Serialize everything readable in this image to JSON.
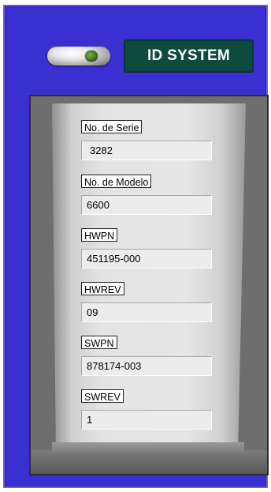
{
  "header": {
    "title": "ID SYSTEM"
  },
  "fields": [
    {
      "label": "No. de Serie",
      "value": "3282"
    },
    {
      "label": "No. de Modelo",
      "value": "6600"
    },
    {
      "label": "HWPN",
      "value": "451195-000"
    },
    {
      "label": "HWREV",
      "value": "09"
    },
    {
      "label": "SWPN",
      "value": "878174-003"
    },
    {
      "label": "SWREV",
      "value": "1"
    }
  ],
  "colors": {
    "panel_blue": "#3a2fd0",
    "title_bg": "#0f4a3f",
    "toggle_knob": "#3a6a1c"
  },
  "icons": {
    "toggle": "toggle-switch-icon"
  }
}
